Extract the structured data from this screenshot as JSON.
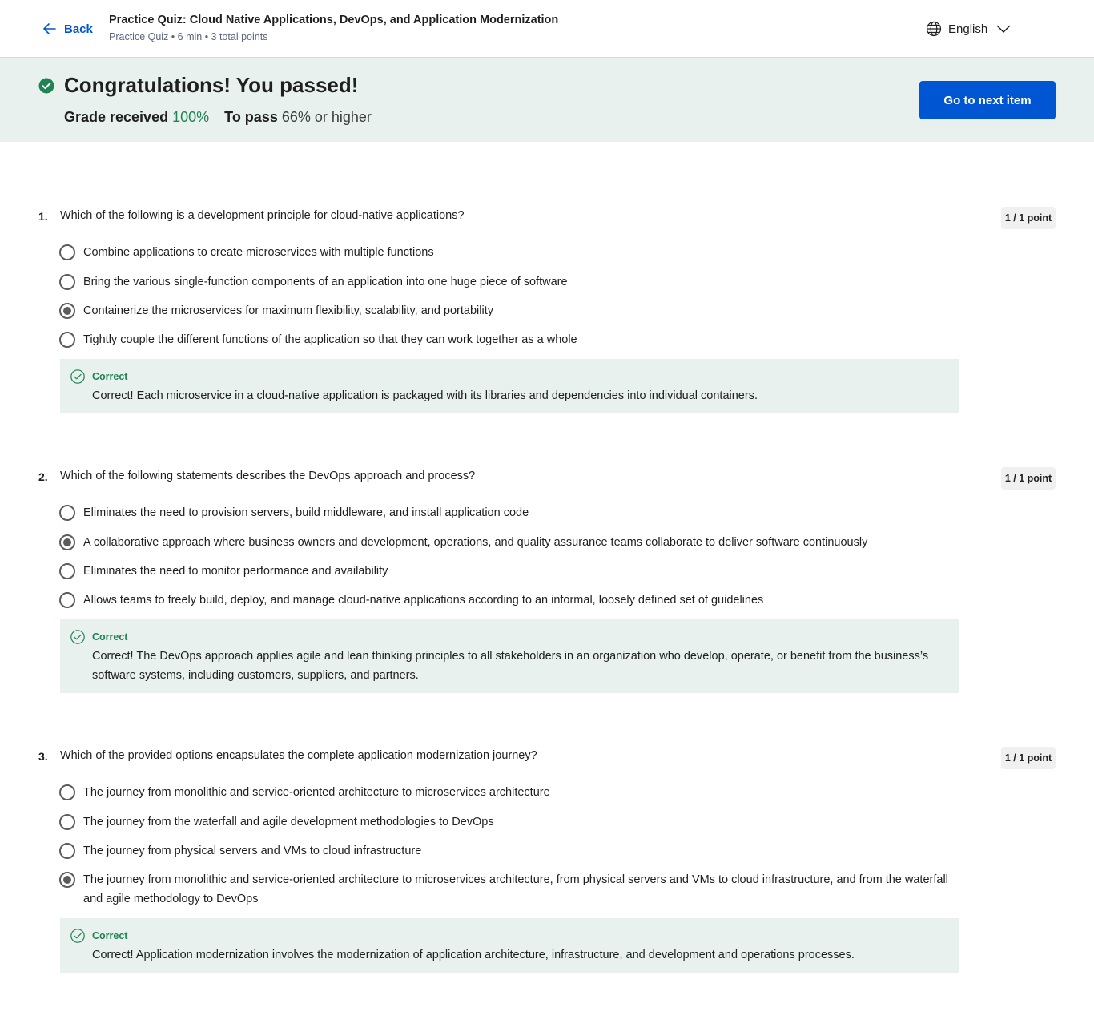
{
  "header": {
    "back_label": "Back",
    "title": "Practice Quiz: Cloud Native Applications, DevOps, and Application Modernization",
    "meta": "Practice Quiz • 6 min • 3 total points",
    "language": "English"
  },
  "banner": {
    "title": "Congratulations! You passed!",
    "grade_label": "Grade received",
    "grade_value": "100%",
    "pass_label": "To pass",
    "pass_value": "66% or higher",
    "next_button": "Go to next item"
  },
  "questions": [
    {
      "number": "1.",
      "text": "Which of the following is a development principle for cloud-native applications?",
      "points": "1 / 1 point",
      "options": [
        "Combine applications to create microservices with multiple functions",
        "Bring the various single-function components of an application into one huge piece of software",
        "Containerize the microservices for maximum flexibility, scalability, and portability",
        "Tightly couple the different functions of the application so that they can work together as a whole"
      ],
      "selected_index": 2,
      "feedback_label": "Correct",
      "feedback_text": "Correct! Each microservice in a cloud-native application is packaged with its libraries and dependencies into individual containers."
    },
    {
      "number": "2.",
      "text": "Which of the following statements describes the DevOps approach and process?",
      "points": "1 / 1 point",
      "options": [
        "Eliminates the need to provision servers, build middleware, and install application code",
        "A collaborative approach where business owners and development, operations, and quality assurance teams collaborate to deliver software continuously",
        "Eliminates the need to monitor performance and availability",
        "Allows teams to freely build, deploy, and manage cloud-native applications according to an informal, loosely defined set of guidelines"
      ],
      "selected_index": 1,
      "feedback_label": "Correct",
      "feedback_text": "Correct! The DevOps approach applies agile and lean thinking principles to all stakeholders in an organization who develop, operate, or benefit from the business’s software systems, including customers, suppliers, and partners."
    },
    {
      "number": "3.",
      "text": "Which of the provided options encapsulates the complete application modernization journey?",
      "points": "1 / 1 point",
      "options": [
        "The journey from monolithic and service-oriented architecture to microservices architecture",
        "The journey from the waterfall and agile development methodologies to DevOps",
        "The journey from physical servers and VMs to cloud infrastructure",
        "The journey from monolithic and service-oriented architecture to microservices architecture, from physical servers and VMs to cloud infrastructure, and from the waterfall and agile methodology to DevOps"
      ],
      "selected_index": 3,
      "feedback_label": "Correct",
      "feedback_text": "Correct! Application modernization involves the modernization of application architecture, infrastructure, and development and operations processes."
    }
  ],
  "colors": {
    "accent": "#0056d2",
    "success": "#1f8354",
    "banner_bg": "#e8f1ee",
    "feedback_bg": "#e8f1ee"
  }
}
